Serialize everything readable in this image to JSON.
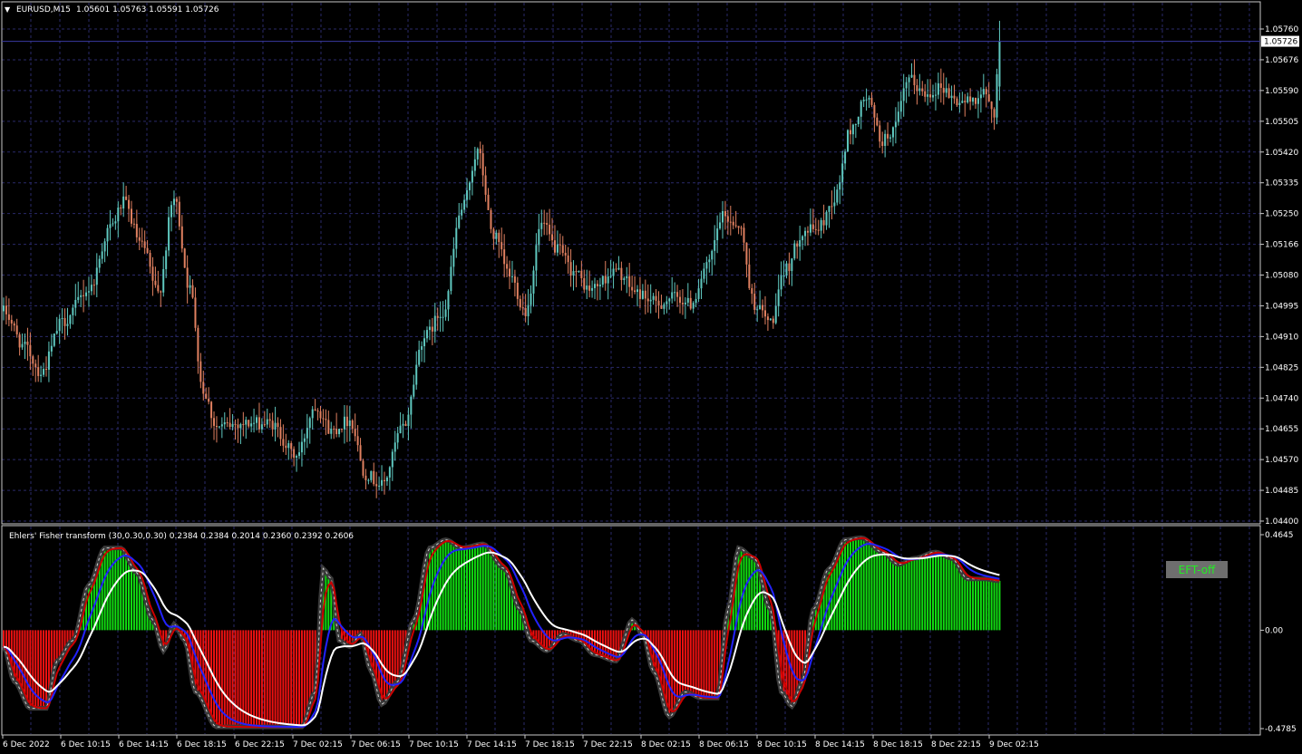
{
  "window": {
    "symbol_caption": "EURUSD,M15",
    "ohlc": "1.05601 1.05763 1.05591 1.05726"
  },
  "price_axis": {
    "labels": [
      "1.05760",
      "1.05676",
      "1.05590",
      "1.05505",
      "1.05420",
      "1.05335",
      "1.05250",
      "1.05166",
      "1.05080",
      "1.04995",
      "1.04910",
      "1.04825",
      "1.04740",
      "1.04655",
      "1.04570",
      "1.04485",
      "1.04400"
    ],
    "current_price": "1.05726",
    "range": [
      1.044,
      1.0576
    ]
  },
  "time_axis": {
    "labels": [
      "6 Dec 2022",
      "6 Dec 10:15",
      "6 Dec 14:15",
      "6 Dec 18:15",
      "6 Dec 22:15",
      "7 Dec 02:15",
      "7 Dec 06:15",
      "7 Dec 10:15",
      "7 Dec 14:15",
      "7 Dec 18:15",
      "7 Dec 22:15",
      "8 Dec 02:15",
      "8 Dec 06:15",
      "8 Dec 10:15",
      "8 Dec 14:15",
      "8 Dec 18:15",
      "8 Dec 22:15",
      "9 Dec 02:15"
    ]
  },
  "indicator": {
    "caption": "Ehlers' Fisher transform (30,0.30,0.30) 0.2384 0.2384 0.2014 0.2360 0.2392 0.2606",
    "axis_labels": [
      "0.4645",
      "0.00",
      "-0.4785"
    ],
    "range": [
      -0.4785,
      0.4645
    ],
    "button_label": "EFT-off"
  },
  "colors": {
    "background": "#000000",
    "grid": "#2a2a6a",
    "axis_border": "#c8c8c8",
    "bull": "#5fc8bf",
    "bear": "#e08060",
    "hist_pos": "#11dd11",
    "hist_neg": "#ee1111",
    "fisher_main": "#3a3a3a",
    "signal_red": "#cc0000",
    "signal_blue": "#2222ff",
    "signal_white": "#ffffff",
    "button_bg": "#6e6e6e",
    "button_text": "#22ee22"
  },
  "chart_data": {
    "type": "candlestick",
    "price_keypoints": [
      [
        0,
        1.0498
      ],
      [
        8,
        1.0488
      ],
      [
        14,
        1.0481
      ],
      [
        22,
        1.0495
      ],
      [
        32,
        1.0504
      ],
      [
        40,
        1.0521
      ],
      [
        45,
        1.0528
      ],
      [
        52,
        1.0516
      ],
      [
        58,
        1.0503
      ],
      [
        64,
        1.0529
      ],
      [
        70,
        1.0504
      ],
      [
        75,
        1.0476
      ],
      [
        80,
        1.0466
      ],
      [
        90,
        1.0467
      ],
      [
        100,
        1.0467
      ],
      [
        110,
        1.0458
      ],
      [
        117,
        1.0472
      ],
      [
        123,
        1.0465
      ],
      [
        130,
        1.0468
      ],
      [
        136,
        1.0453
      ],
      [
        142,
        1.045
      ],
      [
        150,
        1.0466
      ],
      [
        158,
        1.0491
      ],
      [
        165,
        1.0498
      ],
      [
        172,
        1.0526
      ],
      [
        178,
        1.0542
      ],
      [
        184,
        1.0519
      ],
      [
        190,
        1.0508
      ],
      [
        196,
        1.0498
      ],
      [
        202,
        1.0522
      ],
      [
        208,
        1.0515
      ],
      [
        214,
        1.0509
      ],
      [
        220,
        1.0504
      ],
      [
        230,
        1.0509
      ],
      [
        238,
        1.0503
      ],
      [
        246,
        1.05
      ],
      [
        252,
        1.0502
      ],
      [
        258,
        1.05
      ],
      [
        264,
        1.051
      ],
      [
        270,
        1.0524
      ],
      [
        276,
        1.0522
      ],
      [
        282,
        1.05
      ],
      [
        288,
        1.0495
      ],
      [
        294,
        1.051
      ],
      [
        300,
        1.052
      ],
      [
        306,
        1.0521
      ],
      [
        312,
        1.0529
      ],
      [
        318,
        1.0548
      ],
      [
        324,
        1.0557
      ],
      [
        330,
        1.0545
      ],
      [
        334,
        1.0548
      ],
      [
        340,
        1.0562
      ],
      [
        346,
        1.0558
      ],
      [
        352,
        1.056
      ],
      [
        358,
        1.0556
      ],
      [
        362,
        1.0556
      ],
      [
        368,
        1.0558
      ],
      [
        372,
        1.0553
      ],
      [
        374,
        1.0573
      ]
    ],
    "fisher_keypoints": [
      [
        0,
        -0.08
      ],
      [
        4,
        -0.25
      ],
      [
        10,
        -0.38
      ],
      [
        16,
        -0.38
      ],
      [
        20,
        -0.15
      ],
      [
        26,
        -0.05
      ],
      [
        32,
        0.22
      ],
      [
        38,
        0.4
      ],
      [
        44,
        0.4
      ],
      [
        50,
        0.28
      ],
      [
        56,
        0.05
      ],
      [
        60,
        -0.1
      ],
      [
        64,
        0.03
      ],
      [
        68,
        -0.05
      ],
      [
        72,
        -0.3
      ],
      [
        80,
        -0.47
      ],
      [
        90,
        -0.47
      ],
      [
        100,
        -0.47
      ],
      [
        112,
        -0.47
      ],
      [
        117,
        -0.3
      ],
      [
        120,
        0.3
      ],
      [
        123,
        0.25
      ],
      [
        126,
        -0.05
      ],
      [
        130,
        -0.08
      ],
      [
        134,
        -0.02
      ],
      [
        138,
        -0.2
      ],
      [
        142,
        -0.36
      ],
      [
        148,
        -0.25
      ],
      [
        154,
        0.05
      ],
      [
        160,
        0.4
      ],
      [
        166,
        0.44
      ],
      [
        172,
        0.4
      ],
      [
        180,
        0.42
      ],
      [
        188,
        0.3
      ],
      [
        194,
        0.1
      ],
      [
        198,
        -0.05
      ],
      [
        204,
        -0.1
      ],
      [
        210,
        -0.02
      ],
      [
        216,
        -0.05
      ],
      [
        222,
        -0.12
      ],
      [
        230,
        -0.15
      ],
      [
        236,
        0.05
      ],
      [
        240,
        -0.02
      ],
      [
        244,
        -0.2
      ],
      [
        250,
        -0.42
      ],
      [
        256,
        -0.3
      ],
      [
        262,
        -0.33
      ],
      [
        268,
        -0.33
      ],
      [
        272,
        0.1
      ],
      [
        276,
        0.4
      ],
      [
        282,
        0.35
      ],
      [
        288,
        0.1
      ],
      [
        292,
        -0.3
      ],
      [
        296,
        -0.37
      ],
      [
        300,
        -0.25
      ],
      [
        304,
        0.1
      ],
      [
        310,
        0.3
      ],
      [
        316,
        0.44
      ],
      [
        322,
        0.45
      ],
      [
        330,
        0.38
      ],
      [
        336,
        0.32
      ],
      [
        342,
        0.35
      ],
      [
        350,
        0.38
      ],
      [
        356,
        0.35
      ],
      [
        362,
        0.25
      ],
      [
        368,
        0.25
      ],
      [
        374,
        0.24
      ]
    ]
  }
}
